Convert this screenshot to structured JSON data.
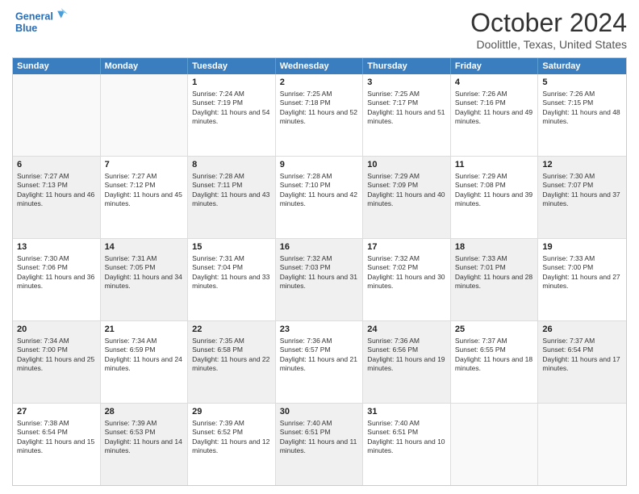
{
  "header": {
    "logo_line1": "General",
    "logo_line2": "Blue",
    "title": "October 2024",
    "subtitle": "Doolittle, Texas, United States"
  },
  "days": [
    "Sunday",
    "Monday",
    "Tuesday",
    "Wednesday",
    "Thursday",
    "Friday",
    "Saturday"
  ],
  "rows": [
    [
      {
        "day": "",
        "sunrise": "",
        "sunset": "",
        "daylight": "",
        "empty": true
      },
      {
        "day": "",
        "sunrise": "",
        "sunset": "",
        "daylight": "",
        "empty": true
      },
      {
        "day": "1",
        "sunrise": "Sunrise: 7:24 AM",
        "sunset": "Sunset: 7:19 PM",
        "daylight": "Daylight: 11 hours and 54 minutes."
      },
      {
        "day": "2",
        "sunrise": "Sunrise: 7:25 AM",
        "sunset": "Sunset: 7:18 PM",
        "daylight": "Daylight: 11 hours and 52 minutes."
      },
      {
        "day": "3",
        "sunrise": "Sunrise: 7:25 AM",
        "sunset": "Sunset: 7:17 PM",
        "daylight": "Daylight: 11 hours and 51 minutes."
      },
      {
        "day": "4",
        "sunrise": "Sunrise: 7:26 AM",
        "sunset": "Sunset: 7:16 PM",
        "daylight": "Daylight: 11 hours and 49 minutes."
      },
      {
        "day": "5",
        "sunrise": "Sunrise: 7:26 AM",
        "sunset": "Sunset: 7:15 PM",
        "daylight": "Daylight: 11 hours and 48 minutes."
      }
    ],
    [
      {
        "day": "6",
        "sunrise": "Sunrise: 7:27 AM",
        "sunset": "Sunset: 7:13 PM",
        "daylight": "Daylight: 11 hours and 46 minutes.",
        "shaded": true
      },
      {
        "day": "7",
        "sunrise": "Sunrise: 7:27 AM",
        "sunset": "Sunset: 7:12 PM",
        "daylight": "Daylight: 11 hours and 45 minutes."
      },
      {
        "day": "8",
        "sunrise": "Sunrise: 7:28 AM",
        "sunset": "Sunset: 7:11 PM",
        "daylight": "Daylight: 11 hours and 43 minutes.",
        "shaded": true
      },
      {
        "day": "9",
        "sunrise": "Sunrise: 7:28 AM",
        "sunset": "Sunset: 7:10 PM",
        "daylight": "Daylight: 11 hours and 42 minutes."
      },
      {
        "day": "10",
        "sunrise": "Sunrise: 7:29 AM",
        "sunset": "Sunset: 7:09 PM",
        "daylight": "Daylight: 11 hours and 40 minutes.",
        "shaded": true
      },
      {
        "day": "11",
        "sunrise": "Sunrise: 7:29 AM",
        "sunset": "Sunset: 7:08 PM",
        "daylight": "Daylight: 11 hours and 39 minutes."
      },
      {
        "day": "12",
        "sunrise": "Sunrise: 7:30 AM",
        "sunset": "Sunset: 7:07 PM",
        "daylight": "Daylight: 11 hours and 37 minutes.",
        "shaded": true
      }
    ],
    [
      {
        "day": "13",
        "sunrise": "Sunrise: 7:30 AM",
        "sunset": "Sunset: 7:06 PM",
        "daylight": "Daylight: 11 hours and 36 minutes."
      },
      {
        "day": "14",
        "sunrise": "Sunrise: 7:31 AM",
        "sunset": "Sunset: 7:05 PM",
        "daylight": "Daylight: 11 hours and 34 minutes.",
        "shaded": true
      },
      {
        "day": "15",
        "sunrise": "Sunrise: 7:31 AM",
        "sunset": "Sunset: 7:04 PM",
        "daylight": "Daylight: 11 hours and 33 minutes."
      },
      {
        "day": "16",
        "sunrise": "Sunrise: 7:32 AM",
        "sunset": "Sunset: 7:03 PM",
        "daylight": "Daylight: 11 hours and 31 minutes.",
        "shaded": true
      },
      {
        "day": "17",
        "sunrise": "Sunrise: 7:32 AM",
        "sunset": "Sunset: 7:02 PM",
        "daylight": "Daylight: 11 hours and 30 minutes."
      },
      {
        "day": "18",
        "sunrise": "Sunrise: 7:33 AM",
        "sunset": "Sunset: 7:01 PM",
        "daylight": "Daylight: 11 hours and 28 minutes.",
        "shaded": true
      },
      {
        "day": "19",
        "sunrise": "Sunrise: 7:33 AM",
        "sunset": "Sunset: 7:00 PM",
        "daylight": "Daylight: 11 hours and 27 minutes."
      }
    ],
    [
      {
        "day": "20",
        "sunrise": "Sunrise: 7:34 AM",
        "sunset": "Sunset: 7:00 PM",
        "daylight": "Daylight: 11 hours and 25 minutes.",
        "shaded": true
      },
      {
        "day": "21",
        "sunrise": "Sunrise: 7:34 AM",
        "sunset": "Sunset: 6:59 PM",
        "daylight": "Daylight: 11 hours and 24 minutes."
      },
      {
        "day": "22",
        "sunrise": "Sunrise: 7:35 AM",
        "sunset": "Sunset: 6:58 PM",
        "daylight": "Daylight: 11 hours and 22 minutes.",
        "shaded": true
      },
      {
        "day": "23",
        "sunrise": "Sunrise: 7:36 AM",
        "sunset": "Sunset: 6:57 PM",
        "daylight": "Daylight: 11 hours and 21 minutes."
      },
      {
        "day": "24",
        "sunrise": "Sunrise: 7:36 AM",
        "sunset": "Sunset: 6:56 PM",
        "daylight": "Daylight: 11 hours and 19 minutes.",
        "shaded": true
      },
      {
        "day": "25",
        "sunrise": "Sunrise: 7:37 AM",
        "sunset": "Sunset: 6:55 PM",
        "daylight": "Daylight: 11 hours and 18 minutes."
      },
      {
        "day": "26",
        "sunrise": "Sunrise: 7:37 AM",
        "sunset": "Sunset: 6:54 PM",
        "daylight": "Daylight: 11 hours and 17 minutes.",
        "shaded": true
      }
    ],
    [
      {
        "day": "27",
        "sunrise": "Sunrise: 7:38 AM",
        "sunset": "Sunset: 6:54 PM",
        "daylight": "Daylight: 11 hours and 15 minutes."
      },
      {
        "day": "28",
        "sunrise": "Sunrise: 7:39 AM",
        "sunset": "Sunset: 6:53 PM",
        "daylight": "Daylight: 11 hours and 14 minutes.",
        "shaded": true
      },
      {
        "day": "29",
        "sunrise": "Sunrise: 7:39 AM",
        "sunset": "Sunset: 6:52 PM",
        "daylight": "Daylight: 11 hours and 12 minutes."
      },
      {
        "day": "30",
        "sunrise": "Sunrise: 7:40 AM",
        "sunset": "Sunset: 6:51 PM",
        "daylight": "Daylight: 11 hours and 11 minutes.",
        "shaded": true
      },
      {
        "day": "31",
        "sunrise": "Sunrise: 7:40 AM",
        "sunset": "Sunset: 6:51 PM",
        "daylight": "Daylight: 11 hours and 10 minutes."
      },
      {
        "day": "",
        "sunrise": "",
        "sunset": "",
        "daylight": "",
        "empty": true
      },
      {
        "day": "",
        "sunrise": "",
        "sunset": "",
        "daylight": "",
        "empty": true
      }
    ]
  ]
}
